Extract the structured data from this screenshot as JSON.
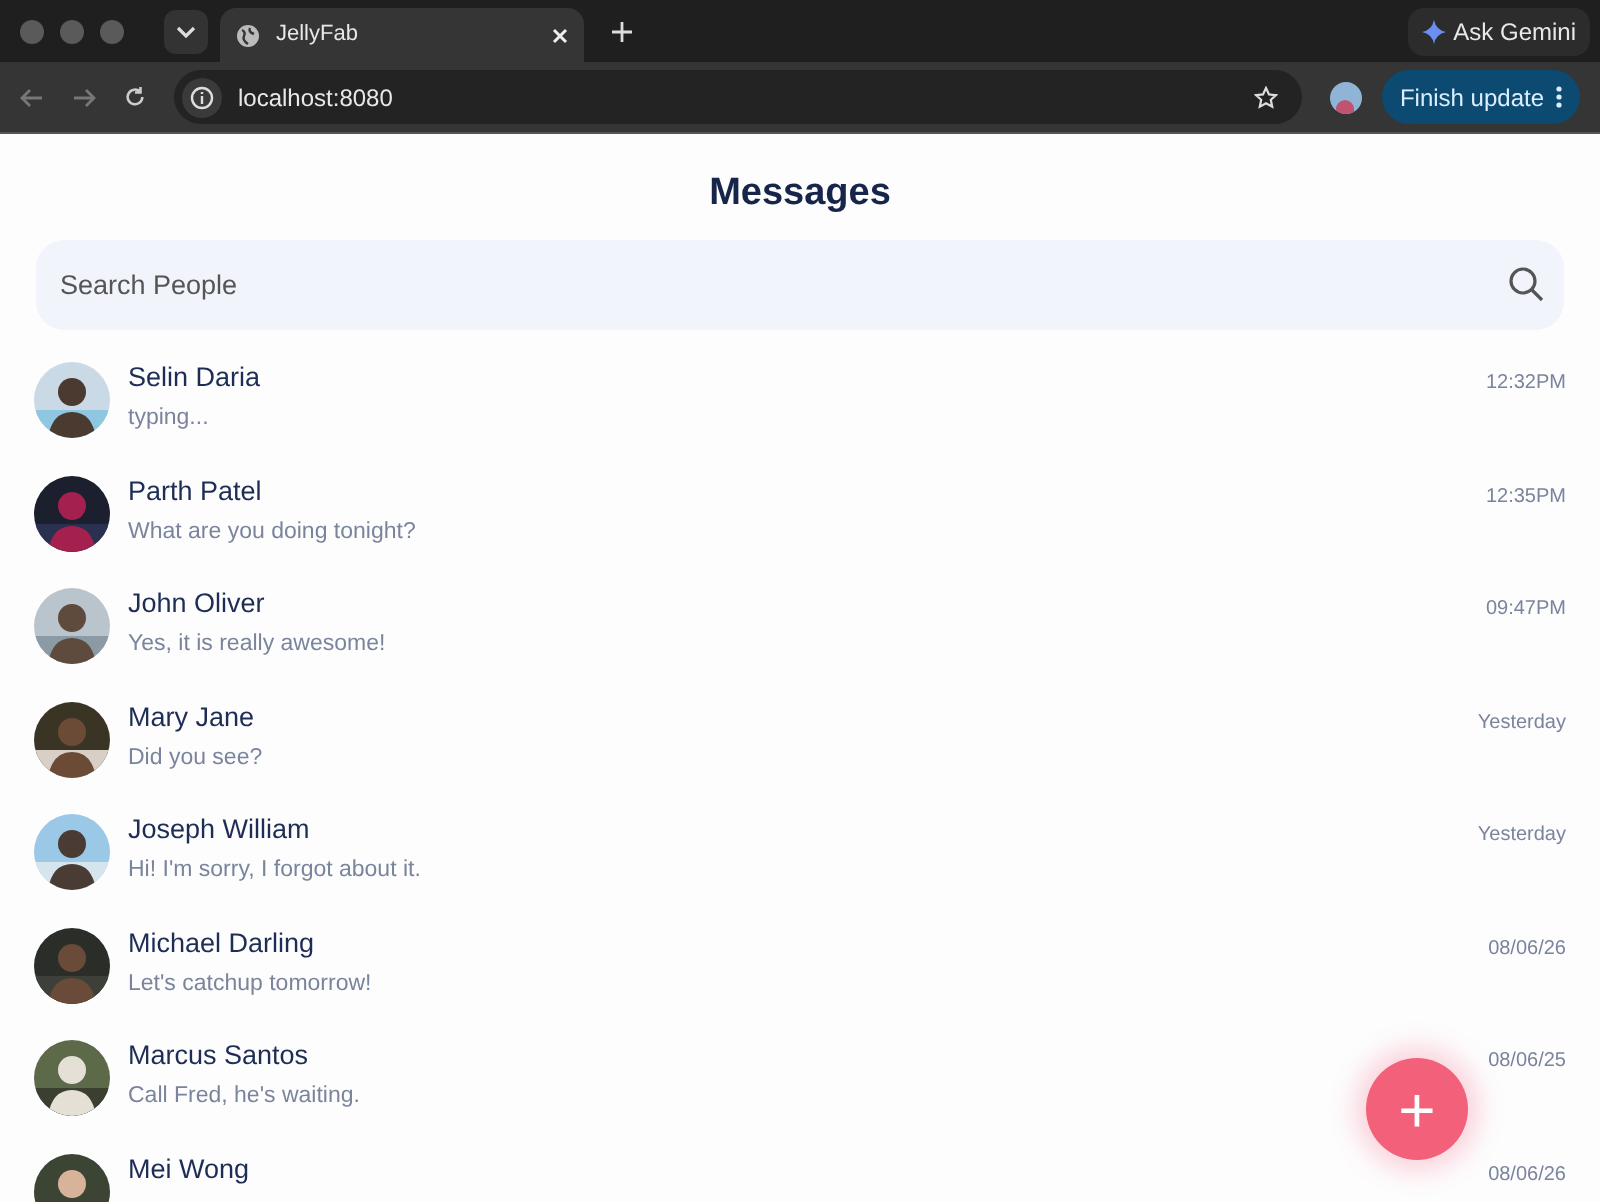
{
  "browser": {
    "tab_title": "JellyFab",
    "address": "localhost:8080",
    "gemini_button": "Ask Gemini",
    "update_button": "Finish update"
  },
  "header": {
    "title": "Messages"
  },
  "search": {
    "placeholder": "Search People"
  },
  "conversations": [
    {
      "name": "Selin Daria",
      "message": "typing...",
      "time": "12:32PM"
    },
    {
      "name": "Parth Patel",
      "message": "What are you doing tonight?",
      "time": "12:35PM"
    },
    {
      "name": "John Oliver",
      "message": "Yes, it is really awesome!",
      "time": "09:47PM"
    },
    {
      "name": "Mary Jane",
      "message": "Did you see?",
      "time": "Yesterday"
    },
    {
      "name": "Joseph William",
      "message": "Hi! I'm sorry, I forgot about it.",
      "time": "Yesterday"
    },
    {
      "name": "Michael Darling",
      "message": "Let's catchup tomorrow!",
      "time": "08/06/26"
    },
    {
      "name": "Marcus Santos",
      "message": "Call Fred, he's waiting.",
      "time": "08/06/25"
    },
    {
      "name": "Mei Wong",
      "time": "08/06/26"
    }
  ],
  "fab": {
    "label": "+"
  }
}
